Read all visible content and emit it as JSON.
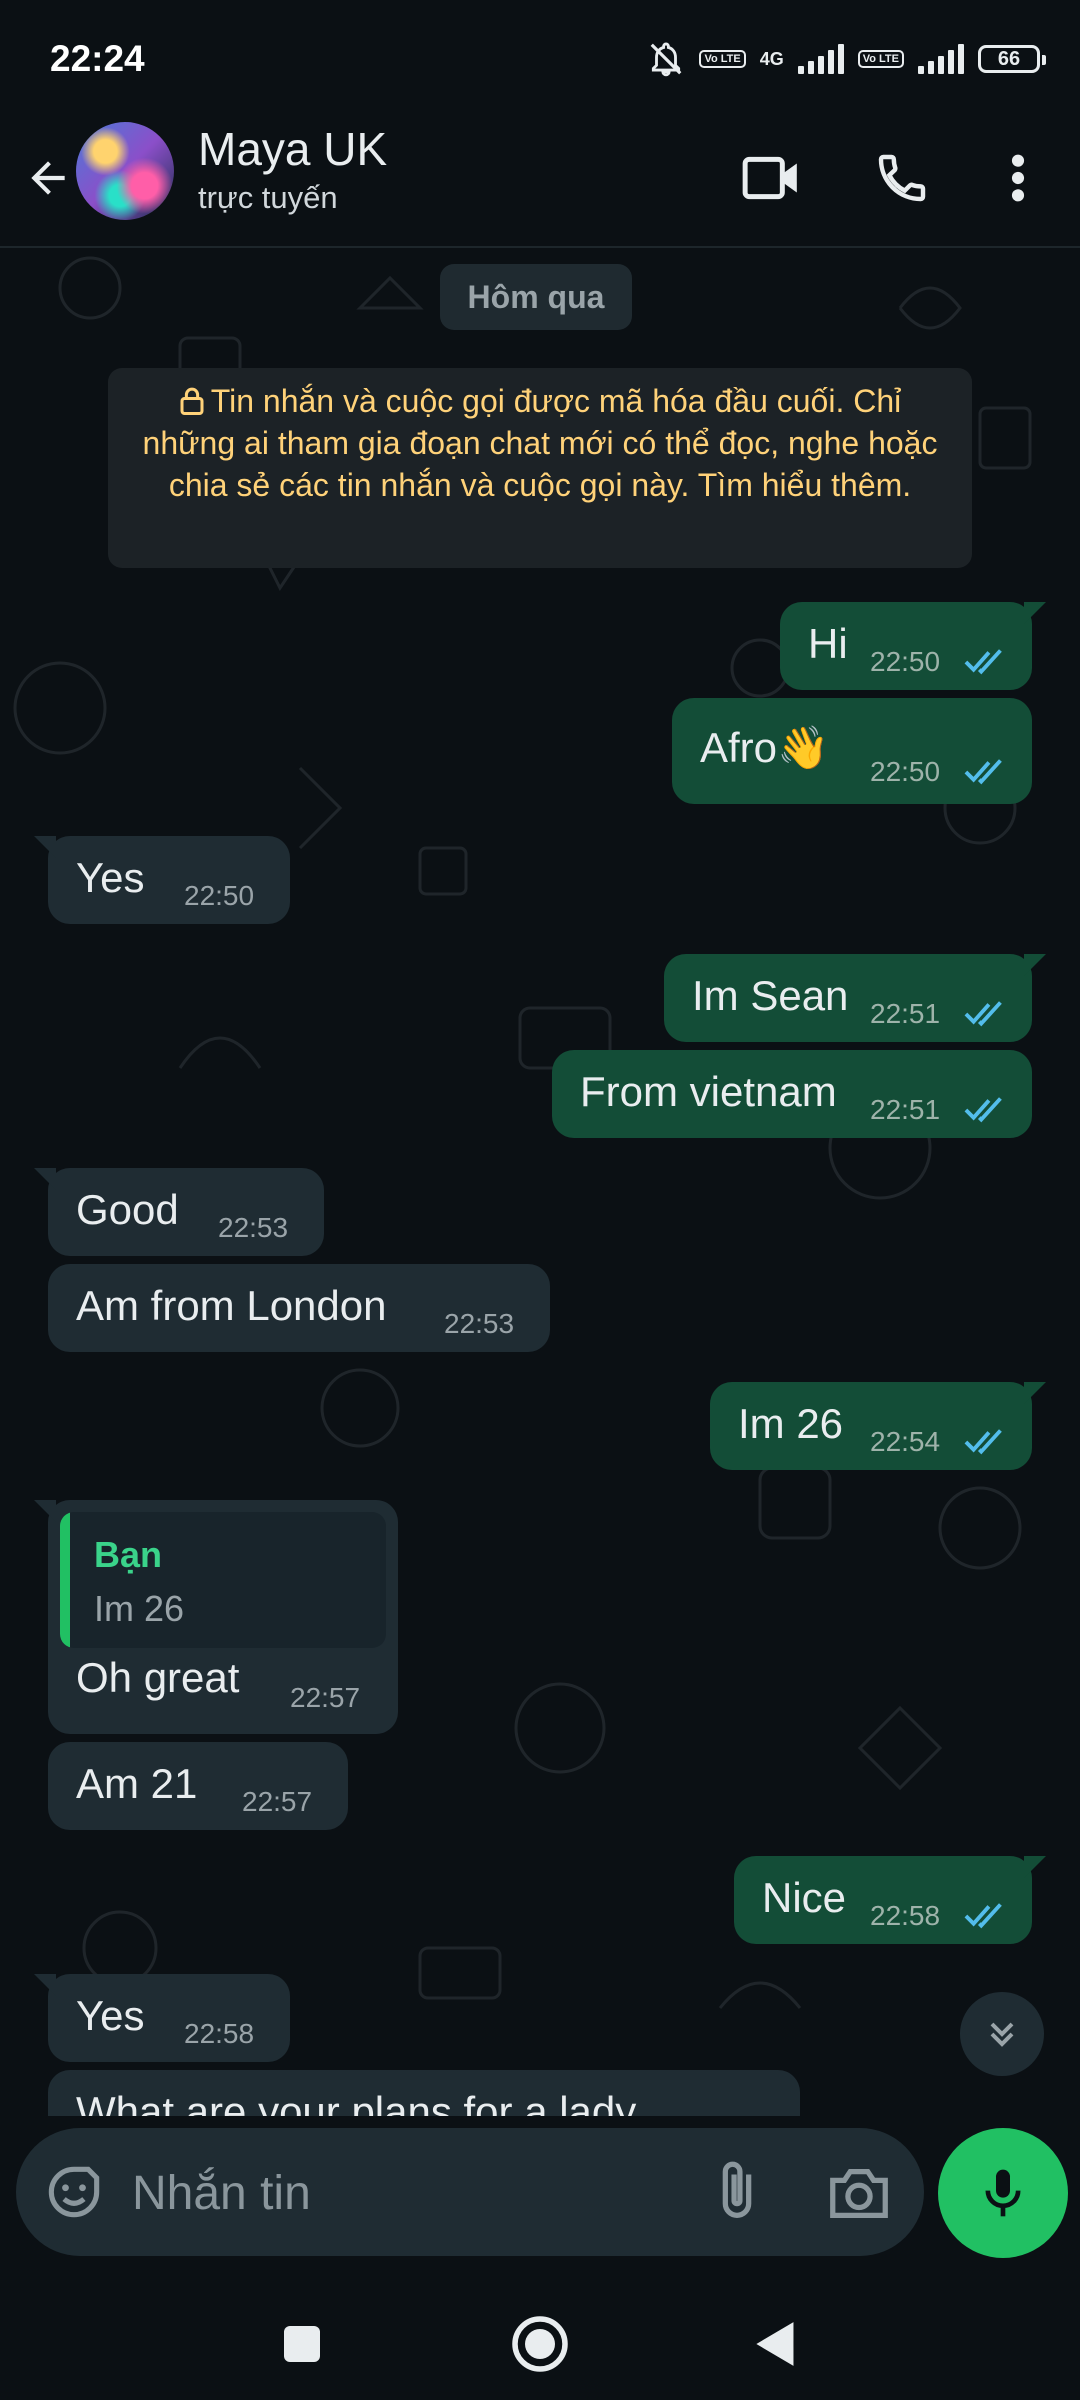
{
  "status_bar": {
    "time": "22:24",
    "sim1": "Vo LTE",
    "net": "4G",
    "sim2": "Vo LTE",
    "battery": "66"
  },
  "header": {
    "name": "Maya UK",
    "status": "trực tuyến"
  },
  "chat": {
    "date_chip": "Hôm qua",
    "encryption_notice": "Tin nhắn và cuộc gọi được mã hóa đầu cuối. Chỉ những ai tham gia đoạn chat mới có thể đọc, nghe hoặc chia sẻ các tin nhắn và cuộc gọi này. Tìm hiểu thêm.",
    "messages": [
      {
        "dir": "out",
        "text": "Hi",
        "time": "22:50"
      },
      {
        "dir": "out",
        "text": "Afro👋",
        "time": "22:50"
      },
      {
        "dir": "in",
        "text": "Yes",
        "time": "22:50"
      },
      {
        "dir": "out",
        "text": "Im Sean",
        "time": "22:51"
      },
      {
        "dir": "out",
        "text": "From vietnam",
        "time": "22:51"
      },
      {
        "dir": "in",
        "text": "Good",
        "time": "22:53"
      },
      {
        "dir": "in",
        "text": "Am from London",
        "time": "22:53"
      },
      {
        "dir": "out",
        "text": "Im 26",
        "time": "22:54"
      },
      {
        "dir": "in",
        "text": "Oh great",
        "time": "22:57",
        "quote": {
          "name": "Bạn",
          "text": "Im 26"
        }
      },
      {
        "dir": "in",
        "text": "Am 21",
        "time": "22:57"
      },
      {
        "dir": "out",
        "text": "Nice",
        "time": "22:58"
      },
      {
        "dir": "in",
        "text": "Yes",
        "time": "22:58"
      },
      {
        "dir": "in",
        "text": "What are your plans for a lady"
      }
    ]
  },
  "composer": {
    "placeholder": "Nhắn tin"
  },
  "colors": {
    "outgoing": "#134d37",
    "incoming": "#1f2c33",
    "accent": "#21c063",
    "read_ticks": "#53bdeb",
    "notice_text": "#ffd279"
  },
  "icons": [
    "back-arrow-icon",
    "video-call-icon",
    "phone-icon",
    "more-vert-icon",
    "lock-icon",
    "double-check-icon",
    "scroll-down-icon",
    "sticker-icon",
    "attach-icon",
    "camera-icon",
    "mic-icon",
    "recents-icon",
    "home-icon",
    "nav-back-icon"
  ]
}
